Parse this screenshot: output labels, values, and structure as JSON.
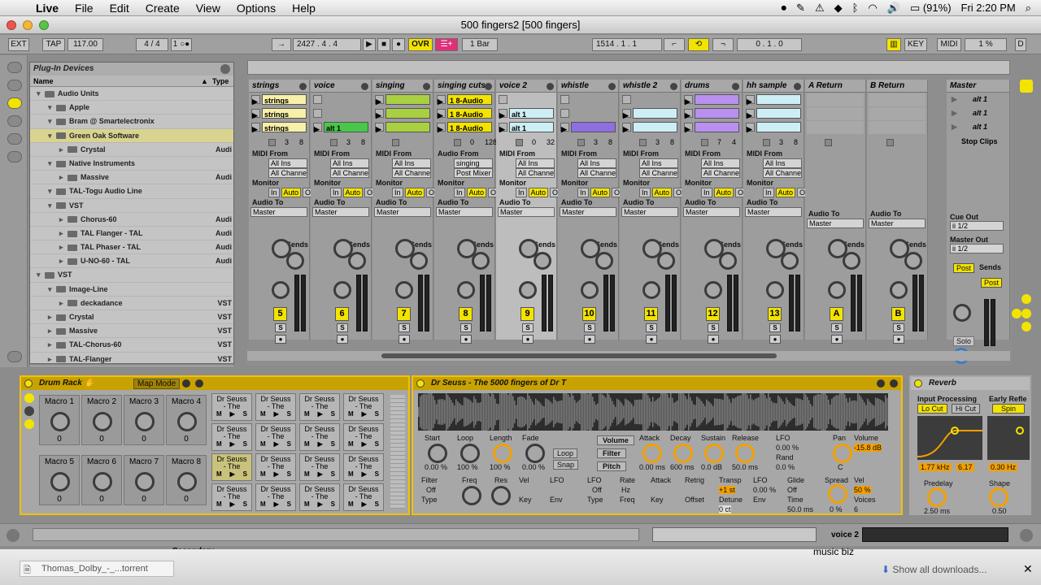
{
  "menubar": {
    "apple": "",
    "app": "Live",
    "items": [
      "File",
      "Edit",
      "Create",
      "View",
      "Options",
      "Help"
    ],
    "battery": "(91%)",
    "clock": "Fri 2:20 PM"
  },
  "window": {
    "title": "500 fingers2  [500 fingers]"
  },
  "transport": {
    "ext": "EXT",
    "tap": "TAP",
    "tempo": "117.00",
    "sig": "4 / 4",
    "metro": "1 ○●",
    "position": "2427 .  4 .  4",
    "ovr": "OVR",
    "quantize": "1 Bar",
    "loop_start": "1514 .  1 .  1",
    "loop_len": "0 .  1 .  0",
    "key": "KEY",
    "midi": "MIDI",
    "cpu": "1 %",
    "disk": "D"
  },
  "browser": {
    "header": "Plug-In Devices",
    "col_name": "Name",
    "col_type": "Type",
    "items": [
      {
        "label": "Audio Units",
        "type": "",
        "indent": 0,
        "folder": true
      },
      {
        "label": "Apple",
        "type": "",
        "indent": 1,
        "folder": true
      },
      {
        "label": "Bram @ Smartelectronix",
        "type": "",
        "indent": 1,
        "folder": true
      },
      {
        "label": "Green Oak Software",
        "type": "",
        "indent": 1,
        "folder": true,
        "selected": true
      },
      {
        "label": "Crystal",
        "type": "Audi",
        "indent": 2,
        "folder": false
      },
      {
        "label": "Native Instruments",
        "type": "",
        "indent": 1,
        "folder": true
      },
      {
        "label": "Massive",
        "type": "Audi",
        "indent": 2,
        "folder": false
      },
      {
        "label": "TAL-Togu Audio Line",
        "type": "",
        "indent": 1,
        "folder": true
      },
      {
        "label": "VST",
        "type": "",
        "indent": 1,
        "folder": true
      },
      {
        "label": "Chorus-60",
        "type": "Audi",
        "indent": 2,
        "folder": false
      },
      {
        "label": "TAL Flanger - TAL",
        "type": "Audi",
        "indent": 2,
        "folder": false
      },
      {
        "label": "TAL Phaser - TAL",
        "type": "Audi",
        "indent": 2,
        "folder": false
      },
      {
        "label": "U-NO-60 - TAL",
        "type": "Audi",
        "indent": 2,
        "folder": false
      },
      {
        "label": "VST",
        "type": "",
        "indent": 0,
        "folder": true
      },
      {
        "label": "Image-Line",
        "type": "",
        "indent": 1,
        "folder": true
      },
      {
        "label": "deckadance",
        "type": "VST",
        "indent": 2,
        "folder": false
      },
      {
        "label": "Crystal",
        "type": "VST",
        "indent": 1,
        "folder": false
      },
      {
        "label": "Massive",
        "type": "VST",
        "indent": 1,
        "folder": false
      },
      {
        "label": "TAL-Chorus-60",
        "type": "VST",
        "indent": 1,
        "folder": false
      },
      {
        "label": "TAL-Flanger",
        "type": "VST",
        "indent": 1,
        "folder": false
      }
    ]
  },
  "session": {
    "tracks": [
      {
        "name": "strings",
        "num": "5",
        "clips": [
          {
            "t": "strings",
            "c": "#f7f0a8"
          },
          {
            "t": "strings",
            "c": "#f7f0a8"
          },
          {
            "t": "strings",
            "c": "#f7f0a8"
          }
        ],
        "in_type": "MIDI From",
        "in": "All Ins",
        "ch": "All Channe",
        "stats": [
          "3",
          "8"
        ]
      },
      {
        "name": "voice",
        "num": "6",
        "clips": [
          {
            "t": "",
            "c": ""
          },
          {
            "t": "",
            "c": ""
          },
          {
            "t": "alt 1",
            "c": "#49c74a"
          }
        ],
        "in_type": "MIDI From",
        "in": "All Ins",
        "ch": "All Channe",
        "stats": [
          "3",
          "8"
        ]
      },
      {
        "name": "singing",
        "num": "7",
        "clips": [
          {
            "t": "",
            "c": "#a8d040"
          },
          {
            "t": "",
            "c": "#a8d040"
          },
          {
            "t": "",
            "c": "#a8d040"
          }
        ],
        "in_type": "MIDI From",
        "in": "All Ins",
        "ch": "All Channe",
        "stats": [
          "",
          ""
        ]
      },
      {
        "name": "singing cuts",
        "num": "8",
        "clips": [
          {
            "t": "1 8-Audio",
            "c": "#f3e300"
          },
          {
            "t": "1 8-Audio",
            "c": "#f3e300"
          },
          {
            "t": "1 8-Audio",
            "c": "#f3e300"
          }
        ],
        "in_type": "Audio From",
        "in": "singing",
        "ch": "Post Mixer",
        "stats": [
          "0",
          "128"
        ]
      },
      {
        "name": "voice 2",
        "num": "9",
        "clips": [
          {
            "t": "",
            "c": ""
          },
          {
            "t": "alt 1",
            "c": "#cdeef5"
          },
          {
            "t": "alt 1",
            "c": "#cdeef5"
          }
        ],
        "in_type": "MIDI From",
        "in": "All Ins",
        "ch": "All Channe",
        "stats": [
          "0",
          "32"
        ],
        "sel": true
      },
      {
        "name": "whistle",
        "num": "10",
        "clips": [
          {
            "t": "",
            "c": ""
          },
          {
            "t": "",
            "c": ""
          },
          {
            "t": "",
            "c": "#8d6fe0"
          }
        ],
        "in_type": "MIDI From",
        "in": "All Ins",
        "ch": "All Channe",
        "stats": [
          "3",
          "8"
        ]
      },
      {
        "name": "whistle 2",
        "num": "11",
        "clips": [
          {
            "t": "",
            "c": ""
          },
          {
            "t": "",
            "c": "#cdeef5"
          },
          {
            "t": "",
            "c": "#cdeef5"
          }
        ],
        "in_type": "MIDI From",
        "in": "All Ins",
        "ch": "All Channe",
        "stats": [
          "3",
          "8"
        ]
      },
      {
        "name": "drums",
        "num": "12",
        "clips": [
          {
            "t": "",
            "c": "#b98ff0"
          },
          {
            "t": "",
            "c": "#b98ff0"
          },
          {
            "t": "",
            "c": "#b98ff0"
          }
        ],
        "in_type": "MIDI From",
        "in": "All Ins",
        "ch": "All Channe",
        "stats": [
          "7",
          "4"
        ]
      },
      {
        "name": "hh sample",
        "num": "13",
        "clips": [
          {
            "t": "",
            "c": "#cdeef5"
          },
          {
            "t": "",
            "c": "#cdeef5"
          },
          {
            "t": "",
            "c": "#cdeef5"
          }
        ],
        "in_type": "MIDI From",
        "in": "All Ins",
        "ch": "All Channe",
        "stats": [
          "3",
          "8"
        ]
      },
      {
        "name": "A Return",
        "num": "A",
        "clips": [],
        "in_type": "",
        "in": "",
        "ch": "",
        "stats": [
          "",
          ""
        ],
        "ret": true
      },
      {
        "name": "B Return",
        "num": "B",
        "clips": [],
        "in_type": "",
        "in": "",
        "ch": "",
        "stats": [
          "",
          ""
        ],
        "ret": true
      }
    ],
    "master": {
      "name": "Master",
      "scenes": [
        "alt 1",
        "alt 1",
        "alt 1"
      ],
      "stop": "Stop Clips",
      "cue_out": "Cue Out",
      "cue_val": "ii 1/2",
      "master_out": "Master Out",
      "master_val": "ii 1/2",
      "post": "Post",
      "solo": "Solo"
    },
    "labels": {
      "monitor": "Monitor",
      "in": "In",
      "auto": "Auto",
      "off": "Off",
      "audio_to": "Audio To",
      "master": "Master",
      "sends": "Sends",
      "s": "S"
    }
  },
  "drumrack": {
    "title": "Drum Rack",
    "map": "Map Mode",
    "macros": [
      "Macro 1",
      "Macro 2",
      "Macro 3",
      "Macro 4",
      "Macro 5",
      "Macro 6",
      "Macro 7",
      "Macro 8"
    ],
    "macro_val": "0",
    "pad": "Dr Seuss - The",
    "mss": [
      "M",
      "S"
    ]
  },
  "simpler": {
    "title": "Dr Seuss - The 5000 fingers of Dr T",
    "env": [
      [
        "Start",
        "0.00 %"
      ],
      [
        "Loop",
        "100 %"
      ],
      [
        "Length",
        "100 %"
      ],
      [
        "Fade",
        "0.00 %"
      ]
    ],
    "buttons": [
      "Loop",
      "Snap",
      "Volume",
      "Filter",
      "Pitch"
    ],
    "adsr": [
      [
        "Attack",
        "0.00 ms"
      ],
      [
        "Decay",
        "600 ms"
      ],
      [
        "Sustain",
        "0.0 dB"
      ],
      [
        "Release",
        "50.0 ms"
      ]
    ],
    "lfo": {
      "lfo": "LFO",
      "lfo_val": "0.00 %",
      "rand": "Rand",
      "rand_val": "0.0 %",
      "pan": "Pan",
      "pan_val": "C",
      "volume": "Volume",
      "vol_val": "-15.8 dB"
    },
    "filter": [
      "Filter",
      "Off",
      "Type",
      "Freq",
      "Res",
      "Vel",
      "Key",
      "LFO",
      "Env"
    ],
    "lfo2": [
      "LFO",
      "Off",
      "Type",
      "Rate",
      "Hz",
      "Freq",
      "Attack",
      "Key",
      "Retrig",
      "Offset"
    ],
    "pitch": {
      "transp": "Transp",
      "transp_val": "+1 st",
      "detune": "Detune",
      "detune_val": "0 ct",
      "lfo": "LFO",
      "lfo_val": "0.00 %",
      "env": "Env",
      "glide": "Glide",
      "glide_val": "Off",
      "time": "Time",
      "time_val": "50.0 ms",
      "spread": "Spread",
      "spread_val": "0 %",
      "vel": "Vel",
      "vel_val": "50 %",
      "voices": "Voices",
      "voices_val": "6"
    }
  },
  "reverb": {
    "title": "Reverb",
    "input": "Input Processing",
    "lo": "Lo Cut",
    "hi": "Hi Cut",
    "early": "Early Refle",
    "spin": "Spin",
    "freq": "1.77 kHz",
    "q": "6.17",
    "rate": "0.30 Hz",
    "predelay": "Predelay",
    "predelay_val": "2.50 ms",
    "shape": "Shape",
    "shape_val": "0.50"
  },
  "status": {
    "track": "voice 2",
    "secondary": "Secondary"
  },
  "downloads": {
    "file": "Thomas_Dolby_-_...torrent",
    "music": "music biz",
    "show": "Show all downloads..."
  },
  "colors": {
    "yellow": "#f3e300",
    "orange": "#f3a000",
    "panel": "#9d9d9d"
  }
}
